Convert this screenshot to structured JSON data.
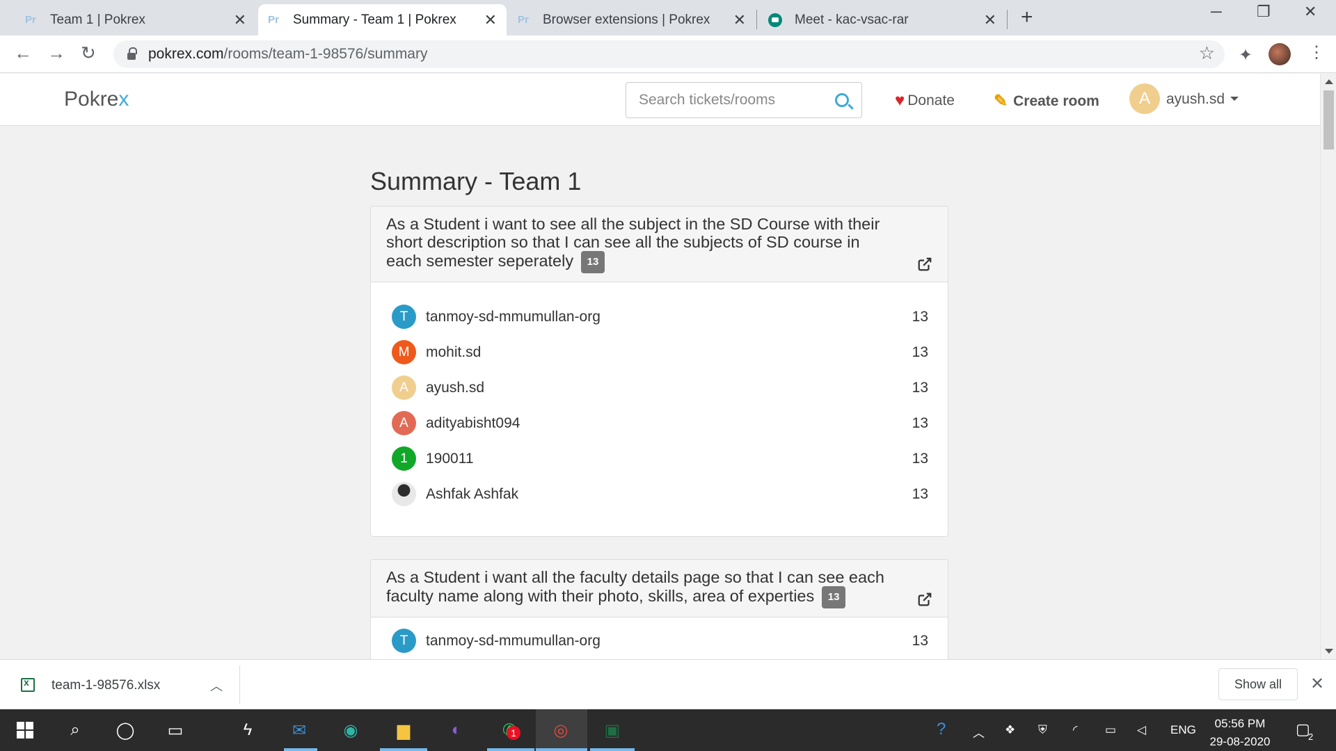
{
  "browser": {
    "tabs": [
      {
        "title": "Team 1 | Pokrex",
        "favicon": "Pr"
      },
      {
        "title": "Summary - Team 1 | Pokrex",
        "favicon": "Pr"
      },
      {
        "title": "Browser extensions | Pokrex",
        "favicon": "Pr"
      },
      {
        "title": "Meet - kac-vsac-rar",
        "favicon": "meet-icon"
      }
    ],
    "url_host": "pokrex.com",
    "url_path": "/rooms/team-1-98576/summary"
  },
  "navbar": {
    "brand_main": "Pokre",
    "brand_accent": "x",
    "search_placeholder": "Search tickets/rooms",
    "donate": "Donate",
    "create_room": "Create room",
    "user_initial": "A",
    "user_name": "ayush.sd"
  },
  "page": {
    "title": "Summary - Team 1"
  },
  "tickets": [
    {
      "text": "As a Student i want to see all the subject in the SD Course with their short description so that I can see all the subjects of SD course in each semester seperately",
      "points": "13",
      "votes": [
        {
          "initial": "T",
          "name": "tanmoy-sd-mmumullan-org",
          "value": "13",
          "color": "#2a9bc7"
        },
        {
          "initial": "M",
          "name": "mohit.sd",
          "value": "13",
          "color": "#ee5a1c"
        },
        {
          "initial": "A",
          "name": "ayush.sd",
          "value": "13",
          "color": "#f0ce8e"
        },
        {
          "initial": "A",
          "name": "adityabisht094",
          "value": "13",
          "color": "#e26a55"
        },
        {
          "initial": "1",
          "name": "190011",
          "value": "13",
          "color": "#11a82a"
        },
        {
          "initial": "",
          "name": "Ashfak Ashfak",
          "value": "13",
          "color": "photo"
        }
      ]
    },
    {
      "text": "As a Student i want all the faculty details page so that I can see each faculty name along with their photo, skills, area of experties",
      "points": "13",
      "votes": [
        {
          "initial": "T",
          "name": "tanmoy-sd-mmumullan-org",
          "value": "13",
          "color": "#2a9bc7"
        }
      ]
    }
  ],
  "downloads": {
    "file_name": "team-1-98576.xlsx",
    "show_all": "Show all"
  },
  "taskbar": {
    "lang": "ENG",
    "time": "05:56 PM",
    "date": "29-08-2020",
    "whatsapp_badge": "1",
    "action_center_count": "2"
  }
}
